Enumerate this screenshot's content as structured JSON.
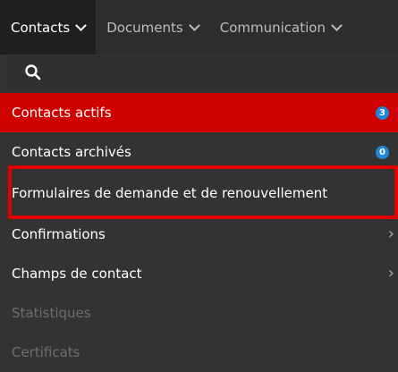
{
  "tabs": [
    {
      "label": "Contacts",
      "active": true
    },
    {
      "label": "Documents",
      "active": false
    },
    {
      "label": "Communication",
      "active": false
    }
  ],
  "search": {
    "icon": "search-icon"
  },
  "menu": {
    "items": [
      {
        "label": "Contacts actifs",
        "state": "active",
        "badge": "3"
      },
      {
        "label": "Contacts archivés",
        "state": "normal",
        "badge": "0"
      },
      {
        "label": "Formulaires de demande et de renouvellement",
        "state": "highlighted"
      },
      {
        "label": "Confirmations",
        "state": "normal",
        "arrow": "›"
      },
      {
        "label": "Champs de contact",
        "state": "normal",
        "arrow": "›"
      },
      {
        "label": "Statistiques",
        "state": "disabled"
      },
      {
        "label": "Certificats",
        "state": "disabled"
      }
    ]
  },
  "colors": {
    "active": "#cf0000",
    "badge": "#1e88d6",
    "highlight": "#e00000"
  }
}
